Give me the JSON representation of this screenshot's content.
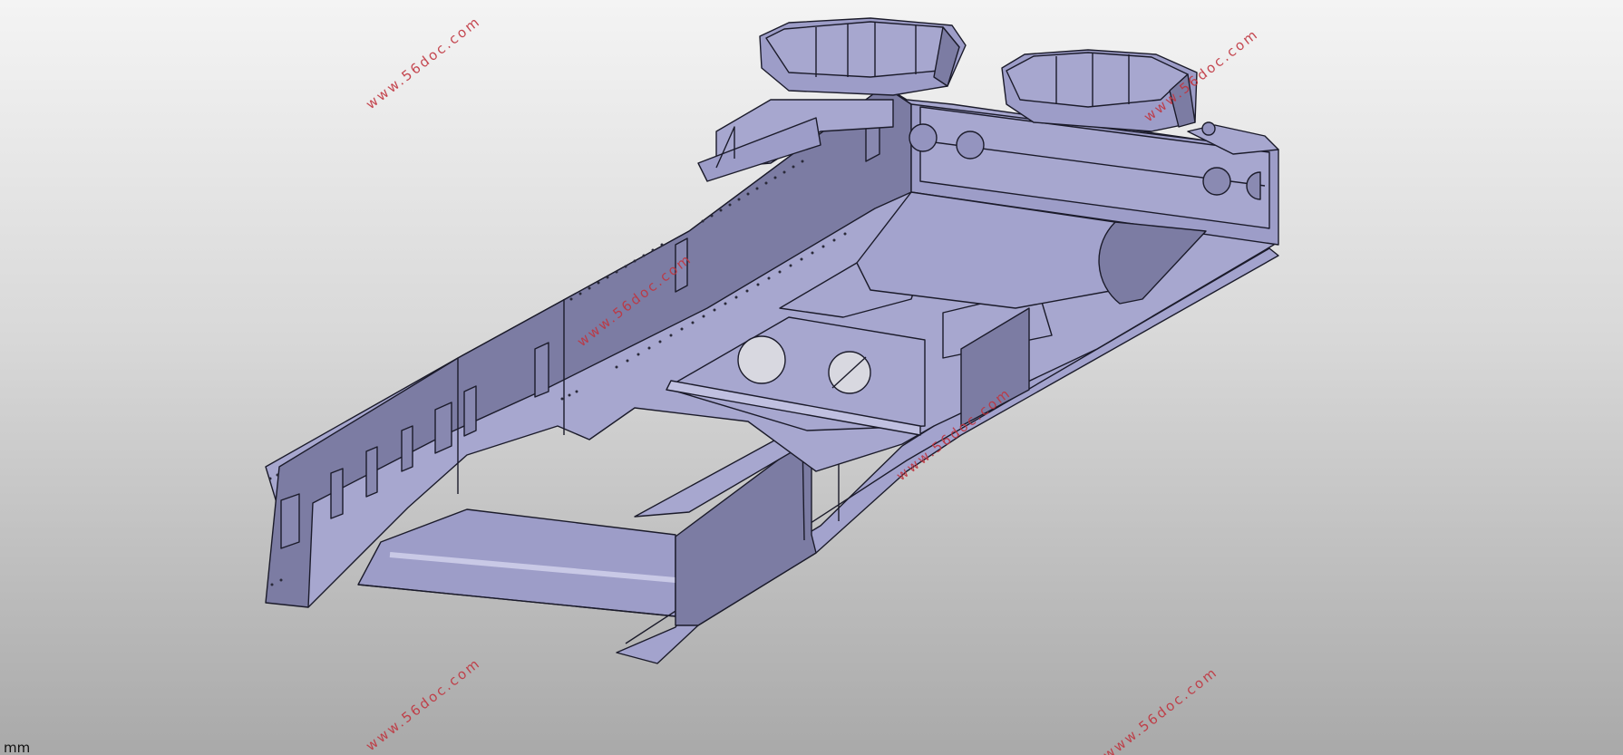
{
  "viewport": {
    "units_label": "mm",
    "model": "chassis-frame",
    "colors": {
      "background_top": "#f4f4f4",
      "background_bottom": "#a9a9a9",
      "part_face": "#a7a7cf",
      "part_shadow": "#7b7ba2",
      "edge": "#1b1b2a",
      "watermark": "#c0353f"
    }
  },
  "watermarks": [
    "www.56doc.com",
    "www.56doc.com",
    "www.56doc.com",
    "www.56doc.com",
    "www.56doc.com",
    "www.56doc.com"
  ]
}
